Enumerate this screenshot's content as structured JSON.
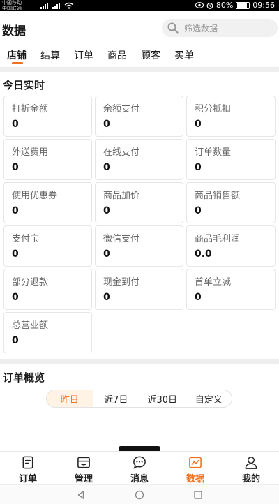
{
  "status_bar": {
    "carrier_1": "中国移动",
    "carrier_2": "中国联通",
    "battery": "80%",
    "time": "09:56"
  },
  "header": {
    "title": "数据",
    "search_placeholder": "筛选数据"
  },
  "tabs": [
    {
      "label": "店铺",
      "active": true
    },
    {
      "label": "结算",
      "active": false
    },
    {
      "label": "订单",
      "active": false
    },
    {
      "label": "商品",
      "active": false
    },
    {
      "label": "顾客",
      "active": false
    },
    {
      "label": "买单",
      "active": false
    }
  ],
  "realtime": {
    "title": "今日实时",
    "metrics": [
      {
        "label": "打折金额",
        "value": "0"
      },
      {
        "label": "余额支付",
        "value": "0"
      },
      {
        "label": "积分抵扣",
        "value": "0"
      },
      {
        "label": "外送费用",
        "value": "0"
      },
      {
        "label": "在线支付",
        "value": "0"
      },
      {
        "label": "订单数量",
        "value": "0"
      },
      {
        "label": "使用优惠券",
        "value": "0"
      },
      {
        "label": "商品加价",
        "value": "0"
      },
      {
        "label": "商品销售额",
        "value": "0"
      },
      {
        "label": "支付宝",
        "value": "0"
      },
      {
        "label": "微信支付",
        "value": "0"
      },
      {
        "label": "商品毛利润",
        "value": "0.0"
      },
      {
        "label": "部分退款",
        "value": "0"
      },
      {
        "label": "现金到付",
        "value": "0"
      },
      {
        "label": "首单立减",
        "value": "0"
      },
      {
        "label": "总营业额",
        "value": "0"
      }
    ]
  },
  "order_overview": {
    "title": "订单概览",
    "ranges": [
      {
        "label": "昨日",
        "active": true
      },
      {
        "label": "近7日",
        "active": false
      },
      {
        "label": "近30日",
        "active": false
      },
      {
        "label": "自定义",
        "active": false
      }
    ]
  },
  "bottom_nav": [
    {
      "label": "订单",
      "icon": "order-icon",
      "active": false
    },
    {
      "label": "管理",
      "icon": "manage-icon",
      "active": false
    },
    {
      "label": "消息",
      "icon": "message-icon",
      "active": false
    },
    {
      "label": "数据",
      "icon": "chart-icon",
      "active": true
    },
    {
      "label": "我的",
      "icon": "user-icon",
      "active": false
    }
  ],
  "colors": {
    "accent": "#f0701f",
    "segment_active_bg": "#fff3e6",
    "divider": "#eeeeee"
  }
}
